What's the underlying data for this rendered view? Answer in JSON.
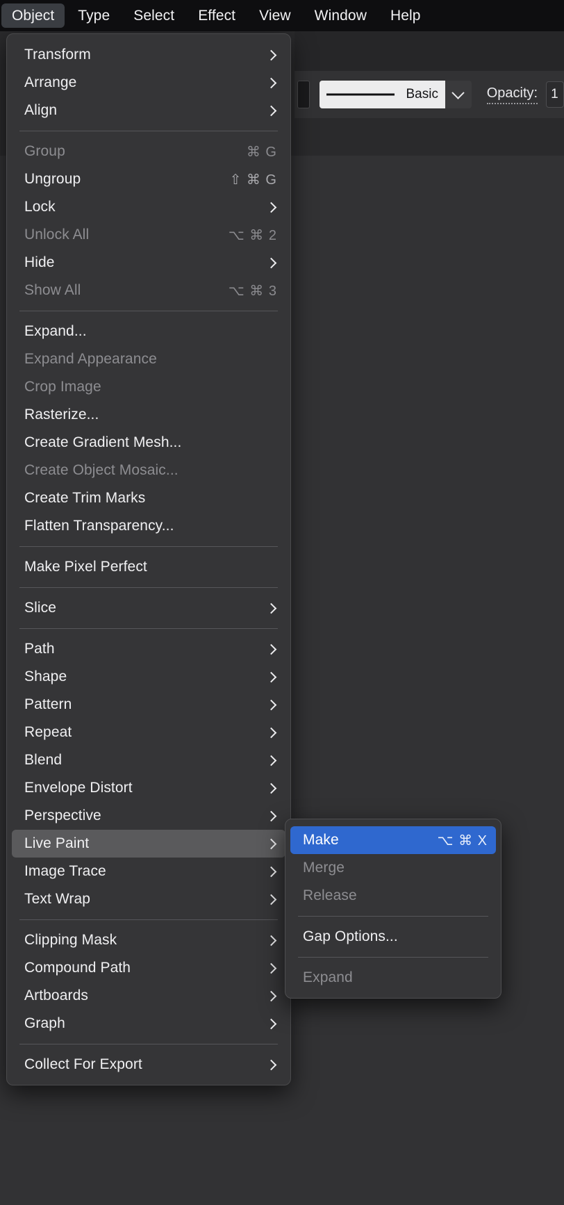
{
  "menubar": {
    "items": [
      {
        "label": "Object",
        "active": true
      },
      {
        "label": "Type",
        "active": false
      },
      {
        "label": "Select",
        "active": false
      },
      {
        "label": "Effect",
        "active": false
      },
      {
        "label": "View",
        "active": false
      },
      {
        "label": "Window",
        "active": false
      },
      {
        "label": "Help",
        "active": false
      }
    ]
  },
  "toolbar": {
    "stroke_profile_value": "Basic",
    "opacity_label": "Opacity:",
    "opacity_value": "1"
  },
  "object_menu": {
    "title": "Object",
    "items": [
      {
        "label": "Transform",
        "shortcut": "",
        "submenu": true,
        "disabled": false,
        "highlighted": false
      },
      {
        "label": "Arrange",
        "shortcut": "",
        "submenu": true,
        "disabled": false,
        "highlighted": false
      },
      {
        "label": "Align",
        "shortcut": "",
        "submenu": true,
        "disabled": false,
        "highlighted": false
      },
      {
        "separator": true
      },
      {
        "label": "Group",
        "shortcut": "⌘ G",
        "submenu": false,
        "disabled": true,
        "highlighted": false
      },
      {
        "label": "Ungroup",
        "shortcut": "⇧ ⌘ G",
        "submenu": false,
        "disabled": false,
        "highlighted": false
      },
      {
        "label": "Lock",
        "shortcut": "",
        "submenu": true,
        "disabled": false,
        "highlighted": false
      },
      {
        "label": "Unlock All",
        "shortcut": "⌥ ⌘ 2",
        "submenu": false,
        "disabled": true,
        "highlighted": false
      },
      {
        "label": "Hide",
        "shortcut": "",
        "submenu": true,
        "disabled": false,
        "highlighted": false
      },
      {
        "label": "Show All",
        "shortcut": "⌥ ⌘ 3",
        "submenu": false,
        "disabled": true,
        "highlighted": false
      },
      {
        "separator": true
      },
      {
        "label": "Expand...",
        "shortcut": "",
        "submenu": false,
        "disabled": false,
        "highlighted": false
      },
      {
        "label": "Expand Appearance",
        "shortcut": "",
        "submenu": false,
        "disabled": true,
        "highlighted": false
      },
      {
        "label": "Crop Image",
        "shortcut": "",
        "submenu": false,
        "disabled": true,
        "highlighted": false
      },
      {
        "label": "Rasterize...",
        "shortcut": "",
        "submenu": false,
        "disabled": false,
        "highlighted": false
      },
      {
        "label": "Create Gradient Mesh...",
        "shortcut": "",
        "submenu": false,
        "disabled": false,
        "highlighted": false
      },
      {
        "label": "Create Object Mosaic...",
        "shortcut": "",
        "submenu": false,
        "disabled": true,
        "highlighted": false
      },
      {
        "label": "Create Trim Marks",
        "shortcut": "",
        "submenu": false,
        "disabled": false,
        "highlighted": false
      },
      {
        "label": "Flatten Transparency...",
        "shortcut": "",
        "submenu": false,
        "disabled": false,
        "highlighted": false
      },
      {
        "separator": true
      },
      {
        "label": "Make Pixel Perfect",
        "shortcut": "",
        "submenu": false,
        "disabled": false,
        "highlighted": false
      },
      {
        "separator": true
      },
      {
        "label": "Slice",
        "shortcut": "",
        "submenu": true,
        "disabled": false,
        "highlighted": false
      },
      {
        "separator": true
      },
      {
        "label": "Path",
        "shortcut": "",
        "submenu": true,
        "disabled": false,
        "highlighted": false
      },
      {
        "label": "Shape",
        "shortcut": "",
        "submenu": true,
        "disabled": false,
        "highlighted": false
      },
      {
        "label": "Pattern",
        "shortcut": "",
        "submenu": true,
        "disabled": false,
        "highlighted": false
      },
      {
        "label": "Repeat",
        "shortcut": "",
        "submenu": true,
        "disabled": false,
        "highlighted": false
      },
      {
        "label": "Blend",
        "shortcut": "",
        "submenu": true,
        "disabled": false,
        "highlighted": false
      },
      {
        "label": "Envelope Distort",
        "shortcut": "",
        "submenu": true,
        "disabled": false,
        "highlighted": false
      },
      {
        "label": "Perspective",
        "shortcut": "",
        "submenu": true,
        "disabled": false,
        "highlighted": false
      },
      {
        "label": "Live Paint",
        "shortcut": "",
        "submenu": true,
        "disabled": false,
        "highlighted": true
      },
      {
        "label": "Image Trace",
        "shortcut": "",
        "submenu": true,
        "disabled": false,
        "highlighted": false
      },
      {
        "label": "Text Wrap",
        "shortcut": "",
        "submenu": true,
        "disabled": false,
        "highlighted": false
      },
      {
        "separator": true
      },
      {
        "label": "Clipping Mask",
        "shortcut": "",
        "submenu": true,
        "disabled": false,
        "highlighted": false
      },
      {
        "label": "Compound Path",
        "shortcut": "",
        "submenu": true,
        "disabled": false,
        "highlighted": false
      },
      {
        "label": "Artboards",
        "shortcut": "",
        "submenu": true,
        "disabled": false,
        "highlighted": false
      },
      {
        "label": "Graph",
        "shortcut": "",
        "submenu": true,
        "disabled": false,
        "highlighted": false
      },
      {
        "separator": true
      },
      {
        "label": "Collect For Export",
        "shortcut": "",
        "submenu": true,
        "disabled": false,
        "highlighted": false
      }
    ]
  },
  "live_paint_submenu": {
    "title": "Live Paint",
    "items": [
      {
        "label": "Make",
        "shortcut": "⌥ ⌘ X",
        "submenu": false,
        "disabled": false,
        "selected": true
      },
      {
        "label": "Merge",
        "shortcut": "",
        "submenu": false,
        "disabled": true,
        "selected": false
      },
      {
        "label": "Release",
        "shortcut": "",
        "submenu": false,
        "disabled": true,
        "selected": false
      },
      {
        "separator": true
      },
      {
        "label": "Gap Options...",
        "shortcut": "",
        "submenu": false,
        "disabled": false,
        "selected": false
      },
      {
        "separator": true
      },
      {
        "label": "Expand",
        "shortcut": "",
        "submenu": false,
        "disabled": true,
        "selected": false
      }
    ]
  },
  "colors": {
    "menu_bg": "#353537",
    "menubar_bg": "#0e0e10",
    "highlight_gray": "#5a5a5c",
    "selection_blue": "#2f68cf",
    "text": "#f0f0f2",
    "text_disabled": "#8d8d91",
    "canvas": "#323234"
  }
}
